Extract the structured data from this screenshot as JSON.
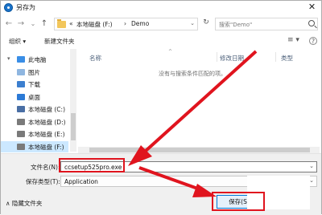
{
  "window": {
    "title": "另存为",
    "close_glyph": "✕"
  },
  "nav_buttons": {
    "back": "←",
    "forward": "→",
    "history": "⌄",
    "up": "↑",
    "refresh": "↻"
  },
  "address": {
    "prefix": "«",
    "drive": "本地磁盘 (F:)",
    "separator": "›",
    "folder": "Demo",
    "dropdown": "⌄"
  },
  "search": {
    "placeholder": "搜索\"Demo\""
  },
  "toolbar": {
    "organize": "组织 ▾",
    "new_folder": "新建文件夹",
    "view_glyph": "≡ ▾",
    "help_glyph": "?"
  },
  "nav_items": [
    {
      "label": "此电脑",
      "icon": "computer-icon",
      "color": "#3a8ee6",
      "expand": "▾"
    },
    {
      "label": "图片",
      "icon": "pictures-icon",
      "color": "#8fb6e0",
      "expand": ""
    },
    {
      "label": "下载",
      "icon": "download-icon",
      "color": "#3c7fcf",
      "expand": ""
    },
    {
      "label": "桌面",
      "icon": "desktop-icon",
      "color": "#2c7ad6",
      "expand": ""
    },
    {
      "label": "本地磁盘 (C:)",
      "icon": "drive-icon",
      "color": "#4a6fa5",
      "expand": ""
    },
    {
      "label": "本地磁盘 (D:)",
      "icon": "drive-icon",
      "color": "#7a7a7a",
      "expand": ""
    },
    {
      "label": "本地磁盘 (E:)",
      "icon": "drive-icon",
      "color": "#7a7a7a",
      "expand": ""
    },
    {
      "label": "本地磁盘 (F:)",
      "icon": "drive-icon",
      "color": "#7a7a7a",
      "expand": "",
      "selected": true
    }
  ],
  "columns": [
    {
      "label": "名称"
    },
    {
      "label": "修改日期"
    },
    {
      "label": "类型"
    }
  ],
  "sort_indicator": "^",
  "empty_message": "没有与搜索条件匹配的项。",
  "form": {
    "filename_label": "文件名(N):",
    "filename_value": "ccsetup525pro.exe",
    "filetype_label": "保存类型(T):",
    "filetype_value": "Application",
    "dropdown_glyph": "⌄",
    "hide_folders": "∧ 隐藏文件夹",
    "save_button": "保存(S)"
  },
  "annotation_color": "#e0141e"
}
